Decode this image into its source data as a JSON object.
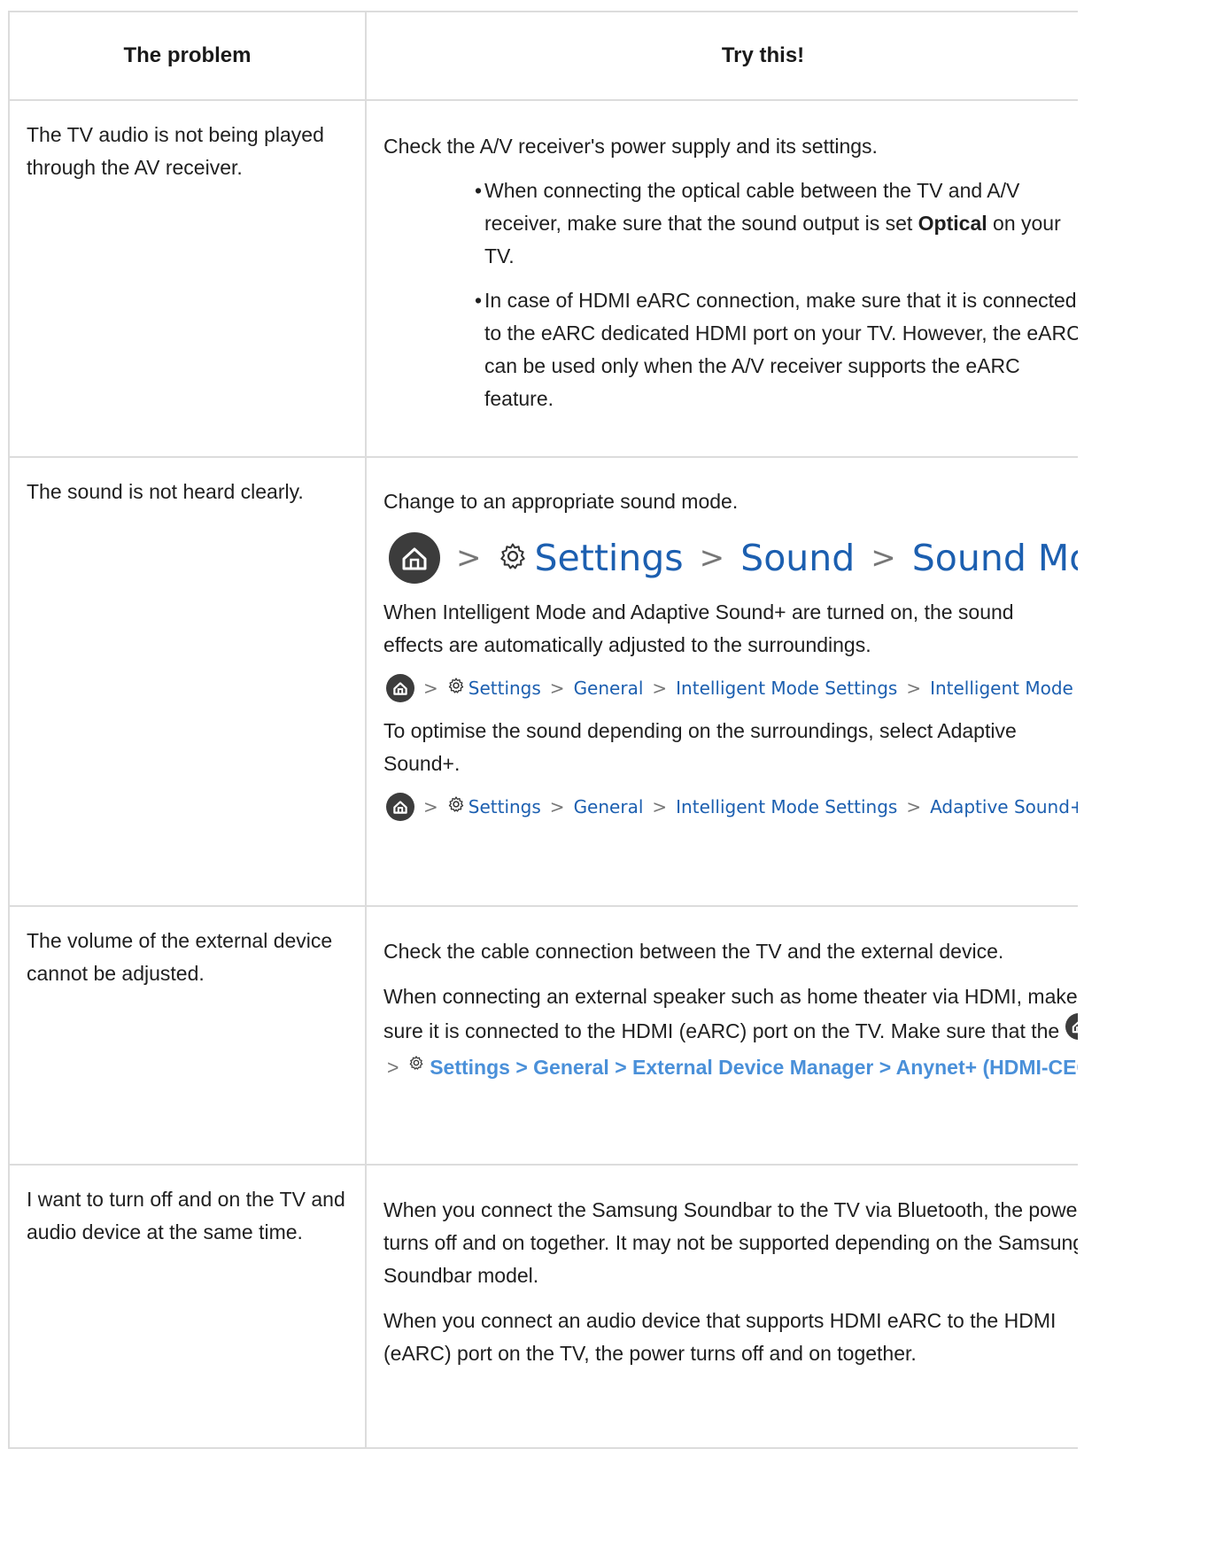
{
  "table": {
    "header": {
      "problem": "The problem",
      "solution": "Try this!"
    },
    "rows": [
      {
        "problem": "The TV audio is not being played through the AV receiver.",
        "intro": "Check the A/V receiver's power supply and its settings.",
        "bullet1": {
          "before": "When connecting the optical cable between the TV and A/V receiver, make sure that the sound output is set ",
          "bold": "Optical",
          "after": " on your TV."
        },
        "bullet2": "In case of HDMI eARC connection, make sure that it is connected to the eARC dedicated HDMI port on your TV. However, the eARC can be used only when the A/V receiver supports the eARC feature."
      },
      {
        "problem": "The sound is not heard clearly.",
        "intro": "Change to an appropriate sound mode.",
        "path1": [
          "Settings",
          "Sound",
          "Sound Mode"
        ],
        "text2": "When Intelligent Mode and Adaptive Sound+ are turned on, the sound effects are automatically adjusted to the surroundings.",
        "path2": [
          "Settings",
          "General",
          "Intelligent Mode Settings",
          "Intelligent Mode"
        ],
        "text3": "To optimise the sound depending on the surroundings, select Adaptive Sound+.",
        "path3": [
          "Settings",
          "General",
          "Intelligent Mode Settings",
          "Adaptive Sound+"
        ]
      },
      {
        "problem": "The volume of the external device cannot be adjusted.",
        "text1": "Check the cable connection between the TV and the external device.",
        "text2_before": "When connecting an external speaker such as home theater via HDMI, make sure it is connected to the HDMI (eARC) port on the TV. Make sure that the ",
        "text2_link": "Settings > General > External Device Manager > Anynet+ (HDMI-CEC)"
      },
      {
        "problem": "I want to turn off and on the TV and audio device at the same time.",
        "text1": "When you connect the Samsung Soundbar to the TV via Bluetooth, the power turns off and on together. It may not be supported depending on the Samsung Soundbar model.",
        "text2": "When you connect an audio device that supports HDMI eARC to the HDMI (eARC) port on the TV, the power turns off and on together."
      }
    ]
  },
  "icons": {
    "home": "home-icon",
    "settings": "gear-icon",
    "separator": ">",
    "bullet": "•"
  }
}
